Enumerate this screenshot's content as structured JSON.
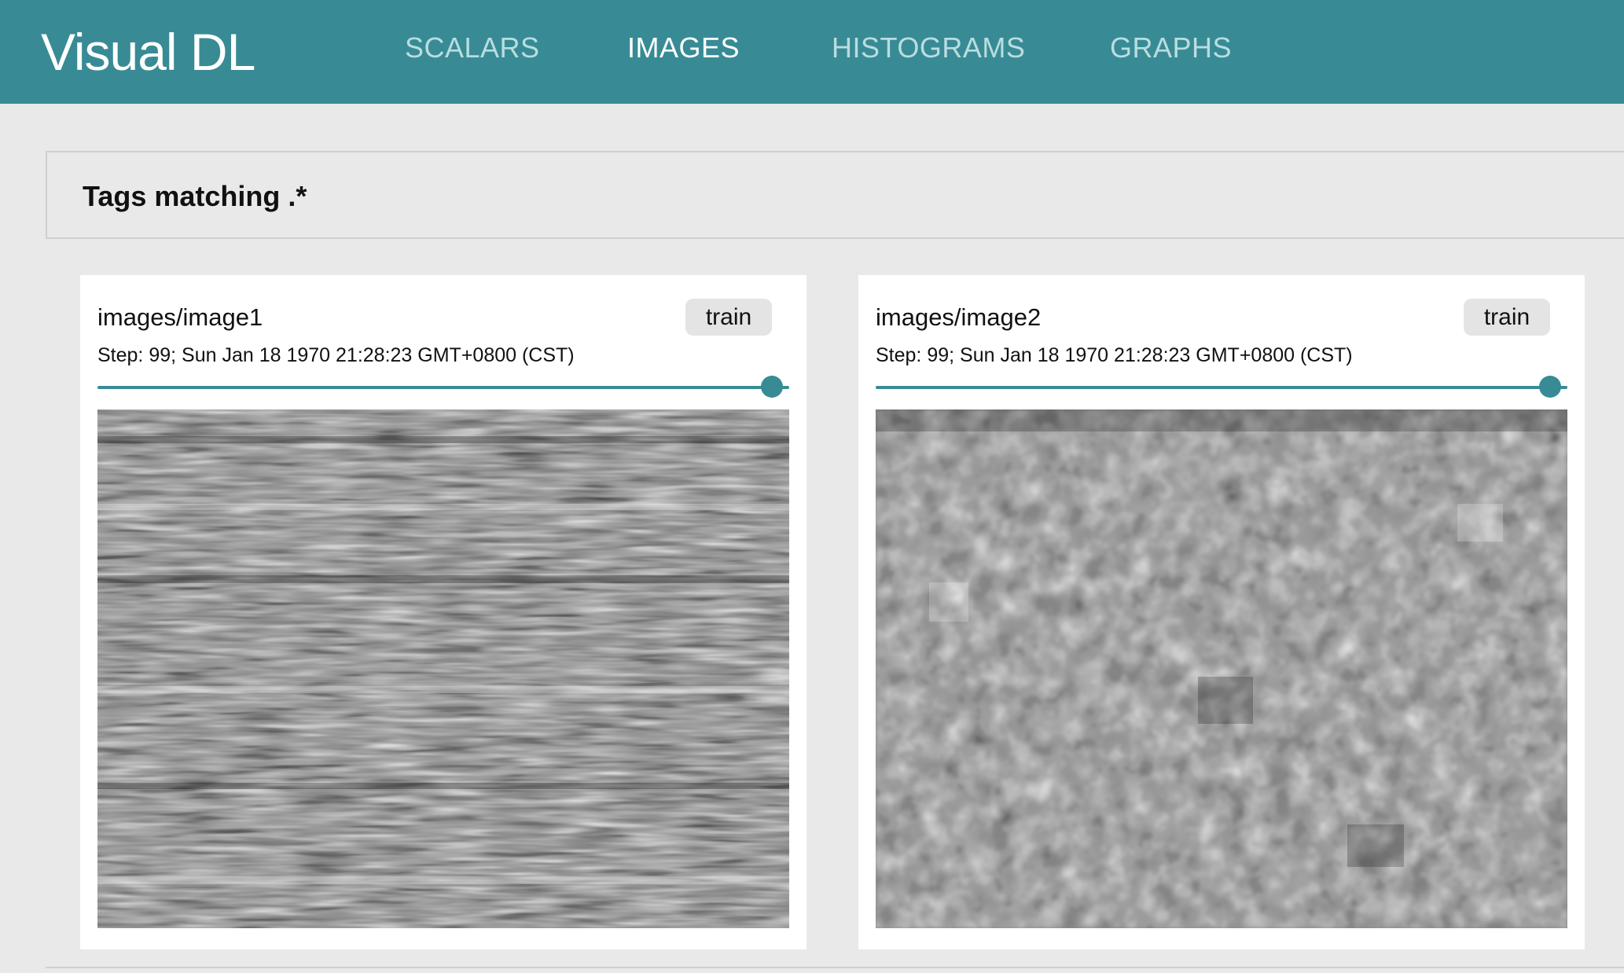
{
  "app": {
    "brand": "Visual DL"
  },
  "nav": {
    "items": [
      {
        "label": "SCALARS",
        "active": false
      },
      {
        "label": "IMAGES",
        "active": true
      },
      {
        "label": "HISTOGRAMS",
        "active": false
      },
      {
        "label": "GRAPHS",
        "active": false
      }
    ]
  },
  "filter": {
    "title": "Tags matching .*"
  },
  "cards": [
    {
      "title": "images/image1",
      "run": "train",
      "step_text": "Step: 99; Sun Jan 18 1970 21:28:23 GMT+0800 (CST)",
      "slider_fraction": 1.0,
      "image_kind": "horizontal-noise"
    },
    {
      "title": "images/image2",
      "run": "train",
      "step_text": "Step: 99; Sun Jan 18 1970 21:28:23 GMT+0800 (CST)",
      "slider_fraction": 1.0,
      "image_kind": "blocky-noise"
    }
  ],
  "colors": {
    "brand": "#388b95",
    "page_background": "#e9e9e9",
    "card_background": "#ffffff",
    "badge_background": "#e4e4e4",
    "nav_active": "#ffffff",
    "nav_inactive": "#b9dde0"
  },
  "icons": {
    "slider_thumb": "circle-handle"
  }
}
